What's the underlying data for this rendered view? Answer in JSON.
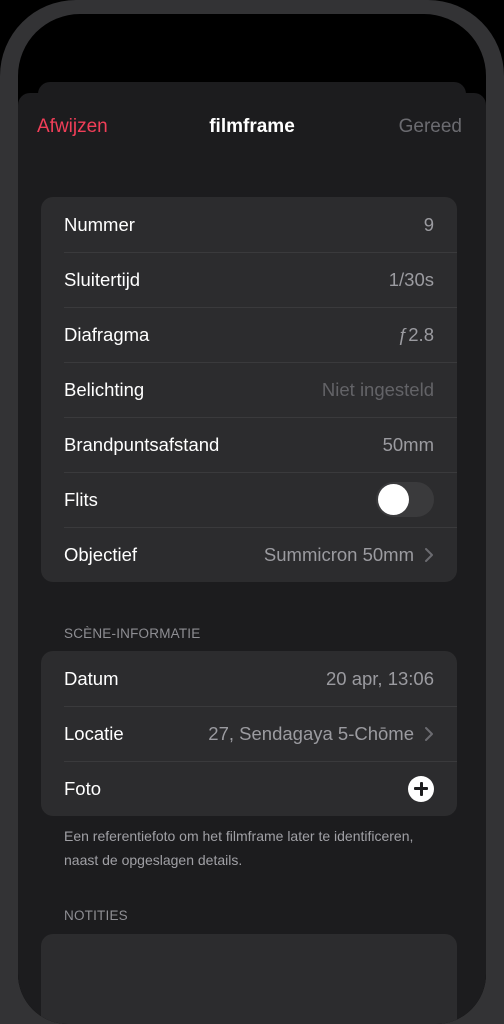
{
  "nav": {
    "cancel_label": "Afwijzen",
    "title": "filmframe",
    "done_label": "Gereed"
  },
  "frame": {
    "number": {
      "label": "Nummer",
      "value": "9"
    },
    "shutter": {
      "label": "Sluitertijd",
      "value": "1/30s"
    },
    "aperture": {
      "label": "Diafragma",
      "value": "ƒ2.8"
    },
    "exposure": {
      "label": "Belichting",
      "value": "Niet ingesteld"
    },
    "focal": {
      "label": "Brandpuntsafstand",
      "value": "50mm"
    },
    "flash": {
      "label": "Flits",
      "on": false
    },
    "lens": {
      "label": "Objectief",
      "value": "Summicron 50mm"
    }
  },
  "scene": {
    "header": "SCÈNE-INFORMATIE",
    "date": {
      "label": "Datum",
      "value": "20 apr, 13:06"
    },
    "location": {
      "label": "Locatie",
      "value": "27, Sendagaya 5-Chōme"
    },
    "photo": {
      "label": "Foto"
    },
    "footer": "Een referentiefoto om het filmframe later te identificeren, naast de opgeslagen details."
  },
  "notes": {
    "header": "NOTITIES"
  },
  "colors": {
    "accent": "#f03e58",
    "sheet_bg": "#1c1c1e",
    "group_bg": "#2c2c2e"
  }
}
